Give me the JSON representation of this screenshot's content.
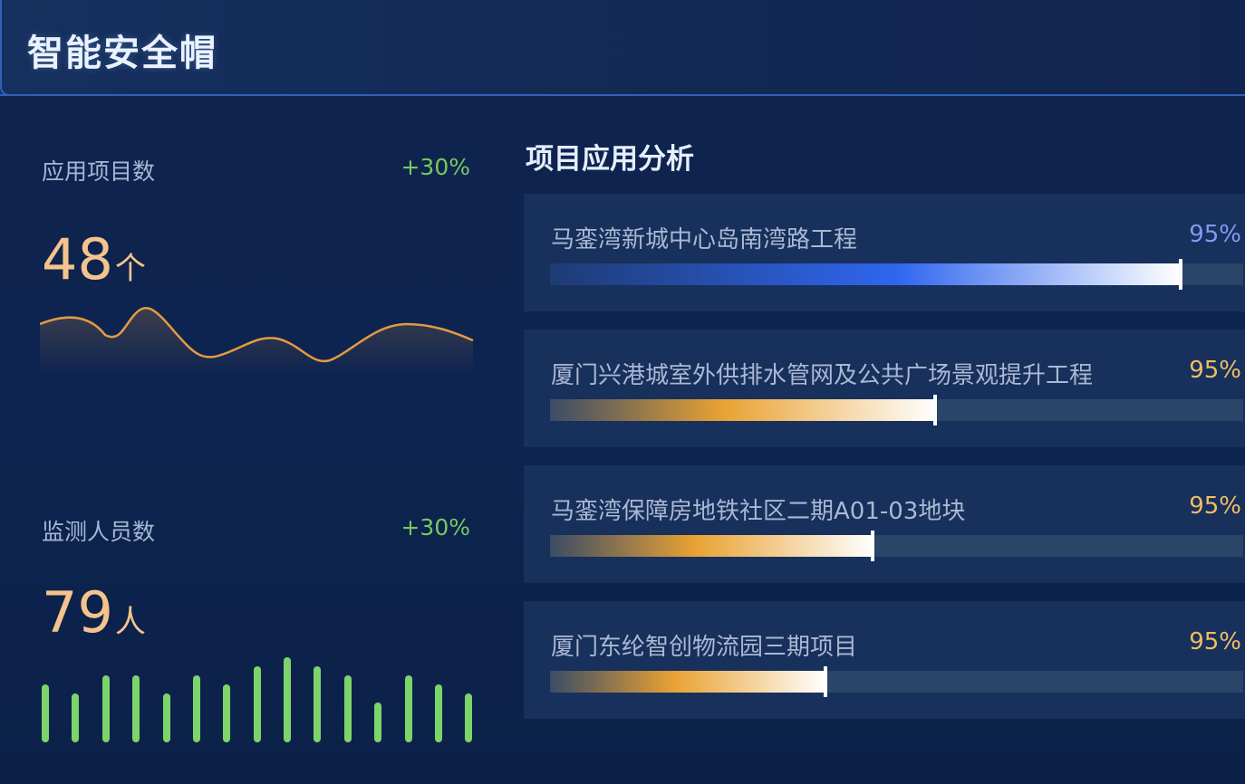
{
  "header": {
    "title": "智能安全帽"
  },
  "stats": {
    "projects": {
      "label": "应用项目数",
      "change": "+30%",
      "value": "48",
      "unit": "个"
    },
    "personnel": {
      "label": "监测人员数",
      "change": "+30%",
      "value": "79",
      "unit": "人"
    }
  },
  "analysis": {
    "title": "项目应用分析",
    "items": [
      {
        "name": "马銮湾新城中心岛南湾路工程",
        "percent": "95%",
        "progress": 0.91,
        "pct_color": "#7f9cf0"
      },
      {
        "name": "厦门兴港城室外供排水管网及公共广场景观提升工程",
        "percent": "95%",
        "progress": 0.555,
        "pct_color": "#f0bd63"
      },
      {
        "name": "马銮湾保障房地铁社区二期A01-03地块",
        "percent": "95%",
        "progress": 0.465,
        "pct_color": "#f0bd63"
      },
      {
        "name": "厦门东纶智创物流园三期项目",
        "percent": "95%",
        "progress": 0.398,
        "pct_color": "#f0bd63"
      }
    ]
  },
  "colors": {
    "accent_green": "#79c95e",
    "value_orange": "#f4c48c",
    "wave_line": "#e39a43",
    "bar_green": "#7dd46a",
    "blue_bar": "#2f66f0",
    "orange_bar": "#e9a233"
  }
}
